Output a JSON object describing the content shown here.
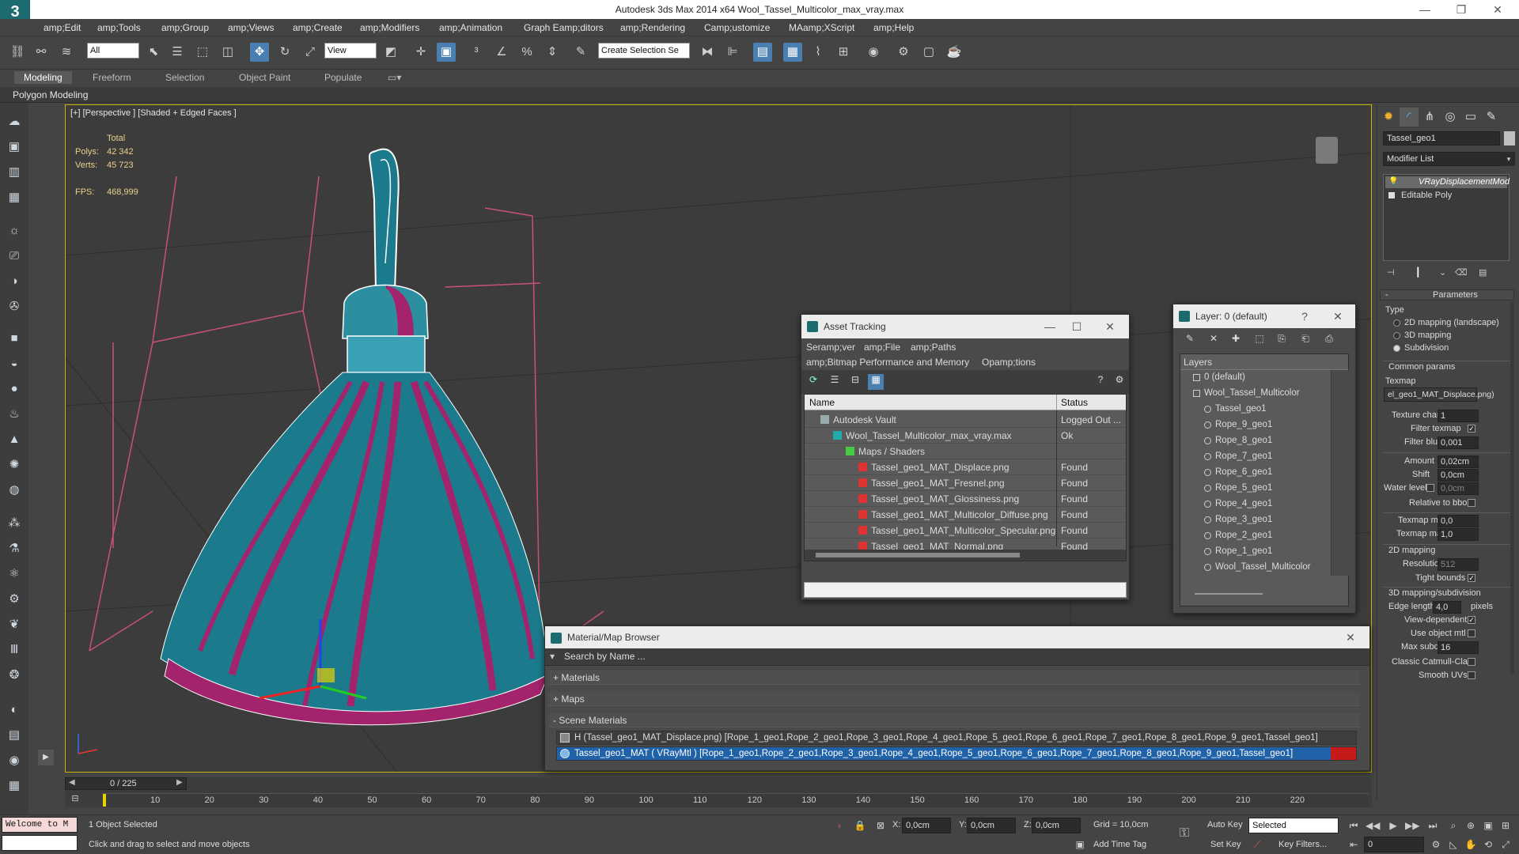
{
  "window": {
    "title": "Autodesk 3ds Max  2014 x64      Wool_Tassel_Multicolor_max_vray.max",
    "logo": "3",
    "minimize_icon": "minimize-icon",
    "restore_icon": "restore-icon",
    "close_icon": "close-icon"
  },
  "menu": [
    "amp;Edit",
    "amp;Tools",
    "amp;Group",
    "amp;Views",
    "amp;Create",
    "amp;Modifiers",
    "amp;Animation",
    "Graph Eamp;ditors",
    "amp;Rendering",
    "Camp;ustomize",
    "MAamp;XScript",
    "amp;Help"
  ],
  "toolbar": {
    "selection_filter": "All",
    "ref_coord": "View",
    "named_selection": "Create Selection Se"
  },
  "ribbon": {
    "tabs": [
      "Modeling",
      "Freeform",
      "Selection",
      "Object Paint",
      "Populate"
    ],
    "active_tab": "Modeling",
    "sub_label": "Polygon Modeling"
  },
  "viewport": {
    "label": "[+] [Perspective ] [Shaded + Edged Faces ]",
    "stats": {
      "total_label": "Total",
      "polys_label": "Polys:",
      "polys_value": "42 342",
      "verts_label": "Verts:",
      "verts_value": "45 723",
      "fps_label": "FPS:",
      "fps_value": "468,999"
    },
    "colors": {
      "teal": "#1b7b8c",
      "magenta": "#a3246d",
      "wire": "#ffffff",
      "grid": "#c9507a"
    }
  },
  "asset_tracking": {
    "title": "Asset Tracking",
    "menu": [
      "Seramp;ver",
      "amp;File",
      "amp;Paths",
      "amp;Bitmap Performance and Memory",
      "Opamp;tions"
    ],
    "columns": [
      "Name",
      "Status"
    ],
    "rows": [
      {
        "name": "Autodesk Vault",
        "status": "Logged Out ...",
        "indent": 0,
        "icon": "vault-icon"
      },
      {
        "name": "Wool_Tassel_Multicolor_max_vray.max",
        "status": "Ok",
        "indent": 1,
        "icon": "max-file-icon"
      },
      {
        "name": "Maps / Shaders",
        "status": "",
        "indent": 2,
        "icon": "maps-icon"
      },
      {
        "name": "Tassel_geo1_MAT_Displace.png",
        "status": "Found",
        "indent": 3,
        "icon": "png-icon"
      },
      {
        "name": "Tassel_geo1_MAT_Fresnel.png",
        "status": "Found",
        "indent": 3,
        "icon": "png-icon"
      },
      {
        "name": "Tassel_geo1_MAT_Glossiness.png",
        "status": "Found",
        "indent": 3,
        "icon": "png-icon"
      },
      {
        "name": "Tassel_geo1_MAT_Multicolor_Diffuse.png",
        "status": "Found",
        "indent": 3,
        "icon": "png-icon"
      },
      {
        "name": "Tassel_geo1_MAT_Multicolor_Specular.png",
        "status": "Found",
        "indent": 3,
        "icon": "png-icon"
      },
      {
        "name": "Tassel_geo1_MAT_Normal.png",
        "status": "Found",
        "indent": 3,
        "icon": "png-icon"
      }
    ]
  },
  "layer_dialog": {
    "title": "Layer: 0 (default)",
    "help": "?",
    "header": "Layers",
    "items": [
      {
        "name": "0 (default)",
        "level": 0,
        "mark": "✓"
      },
      {
        "name": "Wool_Tassel_Multicolor",
        "level": 0,
        "mark": "□"
      },
      {
        "name": "Tassel_geo1",
        "level": 1,
        "mark": ""
      },
      {
        "name": "Rope_9_geo1",
        "level": 1,
        "mark": ""
      },
      {
        "name": "Rope_8_geo1",
        "level": 1,
        "mark": ""
      },
      {
        "name": "Rope_7_geo1",
        "level": 1,
        "mark": ""
      },
      {
        "name": "Rope_6_geo1",
        "level": 1,
        "mark": ""
      },
      {
        "name": "Rope_5_geo1",
        "level": 1,
        "mark": ""
      },
      {
        "name": "Rope_4_geo1",
        "level": 1,
        "mark": ""
      },
      {
        "name": "Rope_3_geo1",
        "level": 1,
        "mark": ""
      },
      {
        "name": "Rope_2_geo1",
        "level": 1,
        "mark": ""
      },
      {
        "name": "Rope_1_geo1",
        "level": 1,
        "mark": ""
      },
      {
        "name": "Wool_Tassel_Multicolor",
        "level": 1,
        "mark": ""
      }
    ]
  },
  "material_browser": {
    "title": "Material/Map Browser",
    "search_placeholder": "Search by Name ...",
    "sections": [
      {
        "label": "+ Materials"
      },
      {
        "label": "+ Maps"
      },
      {
        "label": "- Scene Materials"
      }
    ],
    "scene_items": [
      "H (Tassel_geo1_MAT_Displace.png) [Rope_1_geo1,Rope_2_geo1,Rope_3_geo1,Rope_4_geo1,Rope_5_geo1,Rope_6_geo1,Rope_7_geo1,Rope_8_geo1,Rope_9_geo1,Tassel_geo1]",
      "Tassel_geo1_MAT ( VRayMtl ) [Rope_1_geo1,Rope_2_geo1,Rope_3_geo1,Rope_4_geo1,Rope_5_geo1,Rope_6_geo1,Rope_7_geo1,Rope_8_geo1,Rope_9_geo1,Tassel_geo1]"
    ]
  },
  "command_panel": {
    "object_name": "Tassel_geo1",
    "modifier_list": "Modifier List",
    "stack": [
      "VRayDisplacementMod",
      "Editable Poly"
    ],
    "params_title": "Parameters",
    "type_label": "Type",
    "types": [
      {
        "label": "2D mapping (landscape)",
        "selected": false
      },
      {
        "label": "3D mapping",
        "selected": false
      },
      {
        "label": "Subdivision",
        "selected": true
      }
    ],
    "common_params": "Common params",
    "texmap_label": "Texmap",
    "texmap_value": "el_geo1_MAT_Displace.png)",
    "texture_chan_label": "Texture chan",
    "texture_chan_value": "1",
    "filter_texmap_label": "Filter texmap",
    "filter_blur_label": "Filter blur",
    "filter_blur_value": "0,001",
    "amount_label": "Amount",
    "amount_value": "0,02cm",
    "shift_label": "Shift",
    "shift_value": "0,0cm",
    "water_level_label": "Water level",
    "water_level_value": "0,0cm",
    "relative_bbox_label": "Relative to bbox",
    "texmap_min_label": "Texmap min",
    "texmap_min_value": "0,0",
    "texmap_max_label": "Texmap max",
    "texmap_max_value": "1,0",
    "mapping2d_label": "2D mapping",
    "resolution_label": "Resolution",
    "resolution_value": "512",
    "tight_bounds_label": "Tight bounds",
    "mapping3d_label": "3D mapping/subdivision",
    "edge_length_label": "Edge length",
    "edge_length_value": "4,0",
    "pixels_label": "pixels",
    "view_dependent_label": "View-dependent",
    "use_object_mtl_label": "Use object mtl",
    "max_subdivs_label": "Max subdivs",
    "max_subdivs_value": "16",
    "catmull_label": "Classic Catmull-Clark",
    "smooth_uvs_label": "Smooth UVs"
  },
  "timeline": {
    "frame": "0 / 225",
    "ticks": [
      "10",
      "20",
      "30",
      "40",
      "50",
      "60",
      "70",
      "80",
      "90",
      "100",
      "110",
      "120",
      "130",
      "140",
      "150",
      "160",
      "170",
      "180",
      "190",
      "200",
      "210",
      "220"
    ]
  },
  "status": {
    "maxscript": "Welcome to M",
    "selection_info": "1 Object Selected",
    "prompt": "Click and drag to select and move objects",
    "x_label": "X:",
    "x_value": "0,0cm",
    "y_label": "Y:",
    "y_value": "0,0cm",
    "z_label": "Z:",
    "z_value": "0,0cm",
    "grid": "Grid = 10,0cm",
    "add_time_tag": "Add Time Tag",
    "auto_key": "Auto Key",
    "set_key": "Set Key",
    "selected_dropdown": "Selected",
    "key_filters": "Key Filters...",
    "frame_value": "0"
  }
}
